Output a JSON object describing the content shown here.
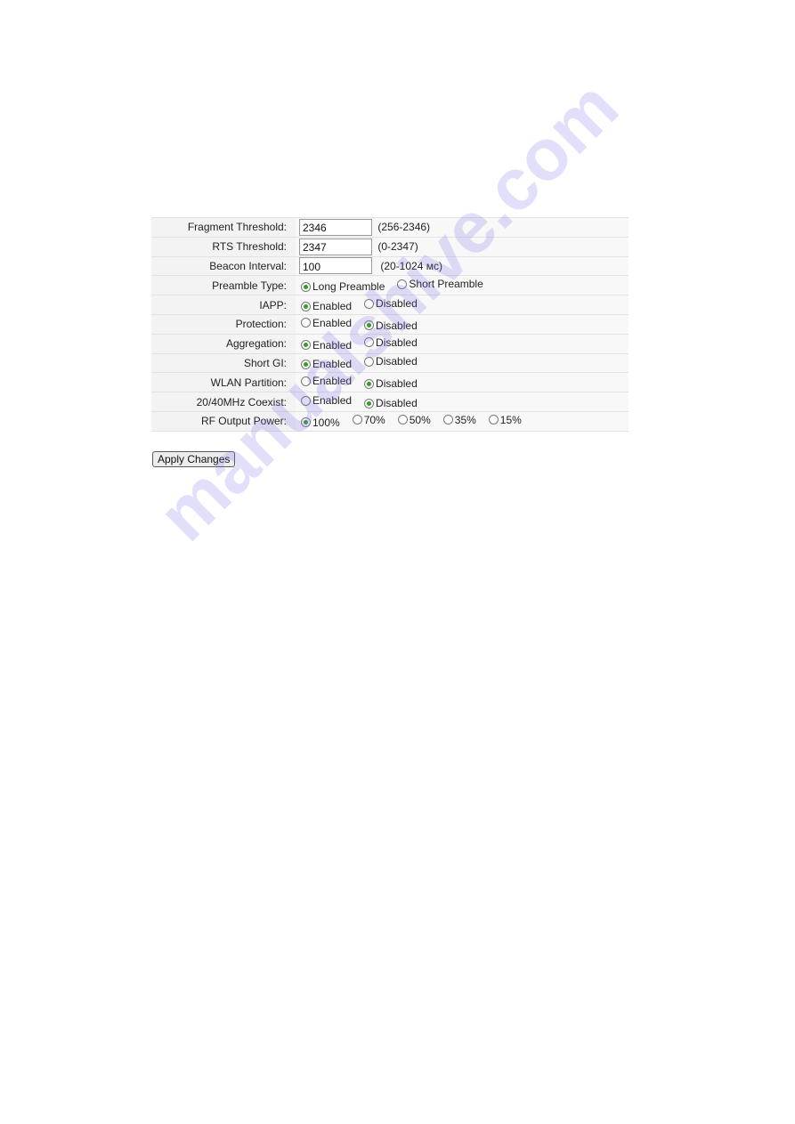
{
  "form": {
    "fragment_threshold": {
      "label": "Fragment Threshold:",
      "value": "2346",
      "range": "(256-2346)"
    },
    "rts_threshold": {
      "label": "RTS Threshold:",
      "value": "2347",
      "range": "(0-2347)"
    },
    "beacon_interval": {
      "label": "Beacon Interval:",
      "value": "100",
      "range": "(20-1024 мс)"
    },
    "preamble_type": {
      "label": "Preamble Type:",
      "options": [
        "Long Preamble",
        "Short Preamble"
      ],
      "selected": "Long Preamble"
    },
    "iapp": {
      "label": "IAPP:",
      "options": [
        "Enabled",
        "Disabled"
      ],
      "selected": "Enabled"
    },
    "protection": {
      "label": "Protection:",
      "options": [
        "Enabled",
        "Disabled"
      ],
      "selected": "Disabled"
    },
    "aggregation": {
      "label": "Aggregation:",
      "options": [
        "Enabled",
        "Disabled"
      ],
      "selected": "Enabled"
    },
    "short_gi": {
      "label": "Short GI:",
      "options": [
        "Enabled",
        "Disabled"
      ],
      "selected": "Enabled"
    },
    "wlan_partition": {
      "label": "WLAN Partition:",
      "options": [
        "Enabled",
        "Disabled"
      ],
      "selected": "Disabled"
    },
    "coexist": {
      "label": "20/40MHz Coexist:",
      "options": [
        "Enabled",
        "Disabled"
      ],
      "selected": "Disabled"
    },
    "rf_output_power": {
      "label": "RF Output Power:",
      "options": [
        "100%",
        "70%",
        "50%",
        "35%",
        "15%"
      ],
      "selected": "100%"
    }
  },
  "apply_button": "Apply Changes",
  "watermark": "manualshive.com",
  "colors": {
    "radio_selected": "#3a9a2a",
    "watermark": "#786ee6"
  }
}
